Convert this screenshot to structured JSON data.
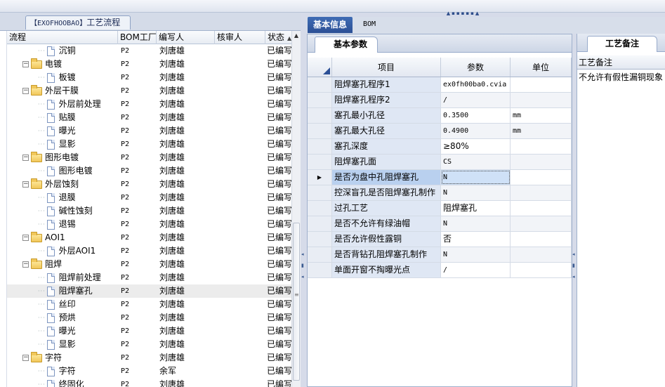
{
  "left_tab": {
    "prefix": "【EXOFHOOBAO】",
    "label": "工艺流程"
  },
  "tree_columns": [
    "流程",
    "BOM工厂",
    "编写人",
    "核审人",
    "状态"
  ],
  "tree_rows": [
    {
      "name": "沉铜",
      "level": 1,
      "folder": false,
      "bom": "P2",
      "writer": "刘唐雄",
      "reviewer": "",
      "status": "已编写"
    },
    {
      "name": "电镀",
      "level": 0,
      "folder": true,
      "bom": "P2",
      "writer": "刘唐雄",
      "reviewer": "",
      "status": "已编写"
    },
    {
      "name": "板镀",
      "level": 1,
      "folder": false,
      "bom": "P2",
      "writer": "刘唐雄",
      "reviewer": "",
      "status": "已编写"
    },
    {
      "name": "外层干膜",
      "level": 0,
      "folder": true,
      "bom": "P2",
      "writer": "刘唐雄",
      "reviewer": "",
      "status": "已编写"
    },
    {
      "name": "外层前处理",
      "level": 1,
      "folder": false,
      "bom": "P2",
      "writer": "刘唐雄",
      "reviewer": "",
      "status": "已编写"
    },
    {
      "name": "贴膜",
      "level": 1,
      "folder": false,
      "bom": "P2",
      "writer": "刘唐雄",
      "reviewer": "",
      "status": "已编写"
    },
    {
      "name": "曝光",
      "level": 1,
      "folder": false,
      "bom": "P2",
      "writer": "刘唐雄",
      "reviewer": "",
      "status": "已编写"
    },
    {
      "name": "显影",
      "level": 1,
      "folder": false,
      "bom": "P2",
      "writer": "刘唐雄",
      "reviewer": "",
      "status": "已编写"
    },
    {
      "name": "图形电镀",
      "level": 0,
      "folder": true,
      "bom": "P2",
      "writer": "刘唐雄",
      "reviewer": "",
      "status": "已编写"
    },
    {
      "name": "图形电镀",
      "level": 1,
      "folder": false,
      "bom": "P2",
      "writer": "刘唐雄",
      "reviewer": "",
      "status": "已编写"
    },
    {
      "name": "外层蚀刻",
      "level": 0,
      "folder": true,
      "bom": "P2",
      "writer": "刘唐雄",
      "reviewer": "",
      "status": "已编写"
    },
    {
      "name": "退膜",
      "level": 1,
      "folder": false,
      "bom": "P2",
      "writer": "刘唐雄",
      "reviewer": "",
      "status": "已编写"
    },
    {
      "name": "碱性蚀刻",
      "level": 1,
      "folder": false,
      "bom": "P2",
      "writer": "刘唐雄",
      "reviewer": "",
      "status": "已编写"
    },
    {
      "name": "退锡",
      "level": 1,
      "folder": false,
      "bom": "P2",
      "writer": "刘唐雄",
      "reviewer": "",
      "status": "已编写"
    },
    {
      "name": "AOI1",
      "level": 0,
      "folder": true,
      "bom": "P2",
      "writer": "刘唐雄",
      "reviewer": "",
      "status": "已编写"
    },
    {
      "name": "外层AOI1",
      "level": 1,
      "folder": false,
      "bom": "P2",
      "writer": "刘唐雄",
      "reviewer": "",
      "status": "已编写"
    },
    {
      "name": "阻焊",
      "level": 0,
      "folder": true,
      "bom": "P2",
      "writer": "刘唐雄",
      "reviewer": "",
      "status": "已编写"
    },
    {
      "name": "阻焊前处理",
      "level": 1,
      "folder": false,
      "bom": "P2",
      "writer": "刘唐雄",
      "reviewer": "",
      "status": "已编写"
    },
    {
      "name": "阻焊塞孔",
      "level": 1,
      "folder": false,
      "bom": "P2",
      "writer": "刘唐雄",
      "reviewer": "",
      "status": "已编写",
      "selected": true
    },
    {
      "name": "丝印",
      "level": 1,
      "folder": false,
      "bom": "P2",
      "writer": "刘唐雄",
      "reviewer": "",
      "status": "已编写"
    },
    {
      "name": "预烘",
      "level": 1,
      "folder": false,
      "bom": "P2",
      "writer": "刘唐雄",
      "reviewer": "",
      "status": "已编写"
    },
    {
      "name": "曝光",
      "level": 1,
      "folder": false,
      "bom": "P2",
      "writer": "刘唐雄",
      "reviewer": "",
      "status": "已编写"
    },
    {
      "name": "显影",
      "level": 1,
      "folder": false,
      "bom": "P2",
      "writer": "刘唐雄",
      "reviewer": "",
      "status": "已编写"
    },
    {
      "name": "字符",
      "level": 0,
      "folder": true,
      "bom": "P2",
      "writer": "刘唐雄",
      "reviewer": "",
      "status": "已编写"
    },
    {
      "name": "字符",
      "level": 1,
      "folder": false,
      "bom": "P2",
      "writer": "余军",
      "reviewer": "",
      "status": "已编写"
    },
    {
      "name": "终固化",
      "level": 1,
      "folder": false,
      "bom": "P2",
      "writer": "刘唐雄",
      "reviewer": "",
      "status": "已编写"
    }
  ],
  "right_tabs": {
    "basic": "基本信息",
    "bom": "BOM"
  },
  "params_tab": "基本参数",
  "params_columns": [
    "项目",
    "参数",
    "单位"
  ],
  "params_rows": [
    {
      "item": "阻焊塞孔程序1",
      "value": "ex0fh00ba0.cvia",
      "unit": "",
      "mono": true
    },
    {
      "item": "阻焊塞孔程序2",
      "value": "/",
      "unit": "",
      "mono": true
    },
    {
      "item": "塞孔最小孔径",
      "value": "0.3500",
      "unit": "mm",
      "mono": true
    },
    {
      "item": "塞孔最大孔径",
      "value": "0.4900",
      "unit": "mm",
      "mono": true
    },
    {
      "item": "塞孔深度",
      "value": "≥80%",
      "unit": "",
      "mono": false
    },
    {
      "item": "阻焊塞孔面",
      "value": "CS",
      "unit": "",
      "mono": true
    },
    {
      "item": "是否为盘中孔阻焊塞孔",
      "value": "N",
      "unit": "",
      "mono": true,
      "current": true
    },
    {
      "item": "控深盲孔是否阻焊塞孔制作",
      "value": "N",
      "unit": "",
      "mono": true
    },
    {
      "item": "过孔工艺",
      "value": "阻焊塞孔",
      "unit": "",
      "mono": false
    },
    {
      "item": "是否不允许有绿油帽",
      "value": "N",
      "unit": "",
      "mono": true
    },
    {
      "item": "是否允许假性露铜",
      "value": "否",
      "unit": "",
      "mono": false
    },
    {
      "item": "是否背钻孔阻焊塞孔制作",
      "value": "N",
      "unit": "",
      "mono": true
    },
    {
      "item": "单面开窗不掏曝光点",
      "value": "/",
      "unit": "",
      "mono": true
    }
  ],
  "notes_tab": "工艺备注",
  "notes_header": "工艺备注",
  "notes_text": "不允许有假性漏铜现象"
}
